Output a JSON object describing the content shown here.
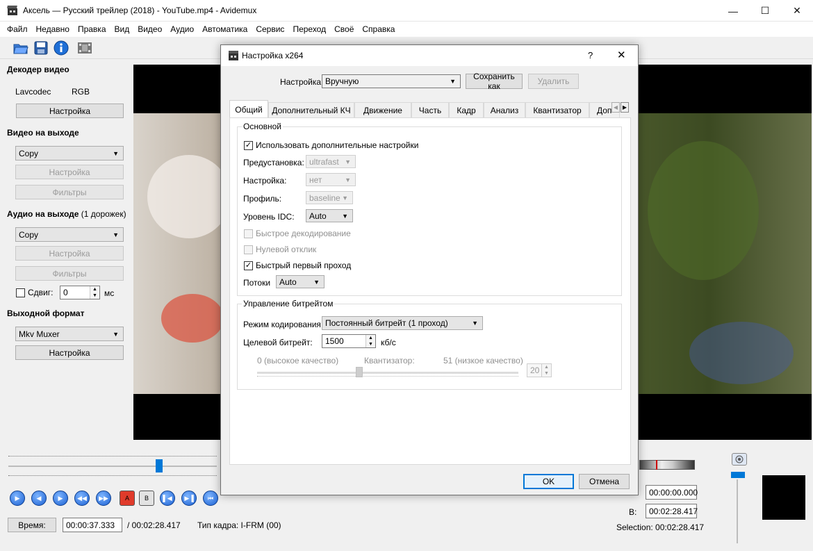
{
  "window": {
    "title": "Аксель — Русский трейлер (2018) - YouTube.mp4 - Avidemux"
  },
  "menu": [
    "Файл",
    "Недавно",
    "Правка",
    "Вид",
    "Видео",
    "Аудио",
    "Автоматика",
    "Сервис",
    "Переход",
    "Своё",
    "Справка"
  ],
  "left_panel": {
    "decoder": {
      "title": "Декодер видео",
      "codec": "Lavcodec",
      "colorspace": "RGB",
      "config_button": "Настройка"
    },
    "video_output": {
      "title": "Видео на выходе",
      "codec": "Copy",
      "config_button": "Настройка",
      "filters_button": "Фильтры"
    },
    "audio_output": {
      "title": "Аудио на выходе",
      "tracks": "(1 дорожек)",
      "codec": "Copy",
      "config_button": "Настройка",
      "filters_button": "Фильтры",
      "shift_label": "Сдвиг:",
      "shift_value": "0",
      "shift_unit": "мс"
    },
    "output_format": {
      "title": "Выходной формат",
      "muxer": "Mkv Muxer",
      "config_button": "Настройка"
    }
  },
  "bottom": {
    "time_button": "Время:",
    "current_time": "00:00:37.333",
    "total_time": "/ 00:02:28.417",
    "frame_type": "Тип кадра:  I-FRM (00)",
    "a_time": "00:00:00.000",
    "b_label": "B:",
    "b_time": "00:02:28.417",
    "selection": "Selection: 00:02:28.417",
    "marker_a": "A",
    "marker_b": "B"
  },
  "dialog": {
    "title": "Настройка x264",
    "help": "?",
    "preset_label": "Настройка",
    "preset_value": "Вручную",
    "save_as": "Сохранить как",
    "delete": "Удалить",
    "tabs": [
      "Общий",
      "Дополнительный КЧ",
      "Движение",
      "Часть",
      "Кадр",
      "Анализ",
      "Квантизатор",
      "Доп"
    ],
    "basic": {
      "title": "Основной",
      "use_advanced": "Использовать дополнительные настройки",
      "preset_label": "Предустановка:",
      "preset_value": "ultrafast",
      "tuning_label": "Настройка:",
      "tuning_value": "нет",
      "profile_label": "Профиль:",
      "profile_value": "baseline",
      "idc_label": "Уровень IDC:",
      "idc_value": "Auto",
      "fast_decode": "Быстрое декодирование",
      "zero_latency": "Нулевой отклик",
      "fast_first_pass": "Быстрый первый проход",
      "threads_label": "Потоки",
      "threads_value": "Auto"
    },
    "bitrate": {
      "title": "Управление битрейтом",
      "mode_label": "Режим кодирования:",
      "mode_value": "Постоянный битрейт (1 проход)",
      "target_label": "Целевой битрейт:",
      "target_value": "1500",
      "target_unit": "кб/с",
      "q_low": "0 (высокое качество)",
      "q_label": "Квантизатор:",
      "q_high": "51 (низкое качество)",
      "q_value": "20",
      "q_fraction": 0.39
    },
    "ok": "OK",
    "cancel": "Отмена"
  },
  "colors": {
    "accent": "#0078d7",
    "video_bg": "#000000"
  }
}
